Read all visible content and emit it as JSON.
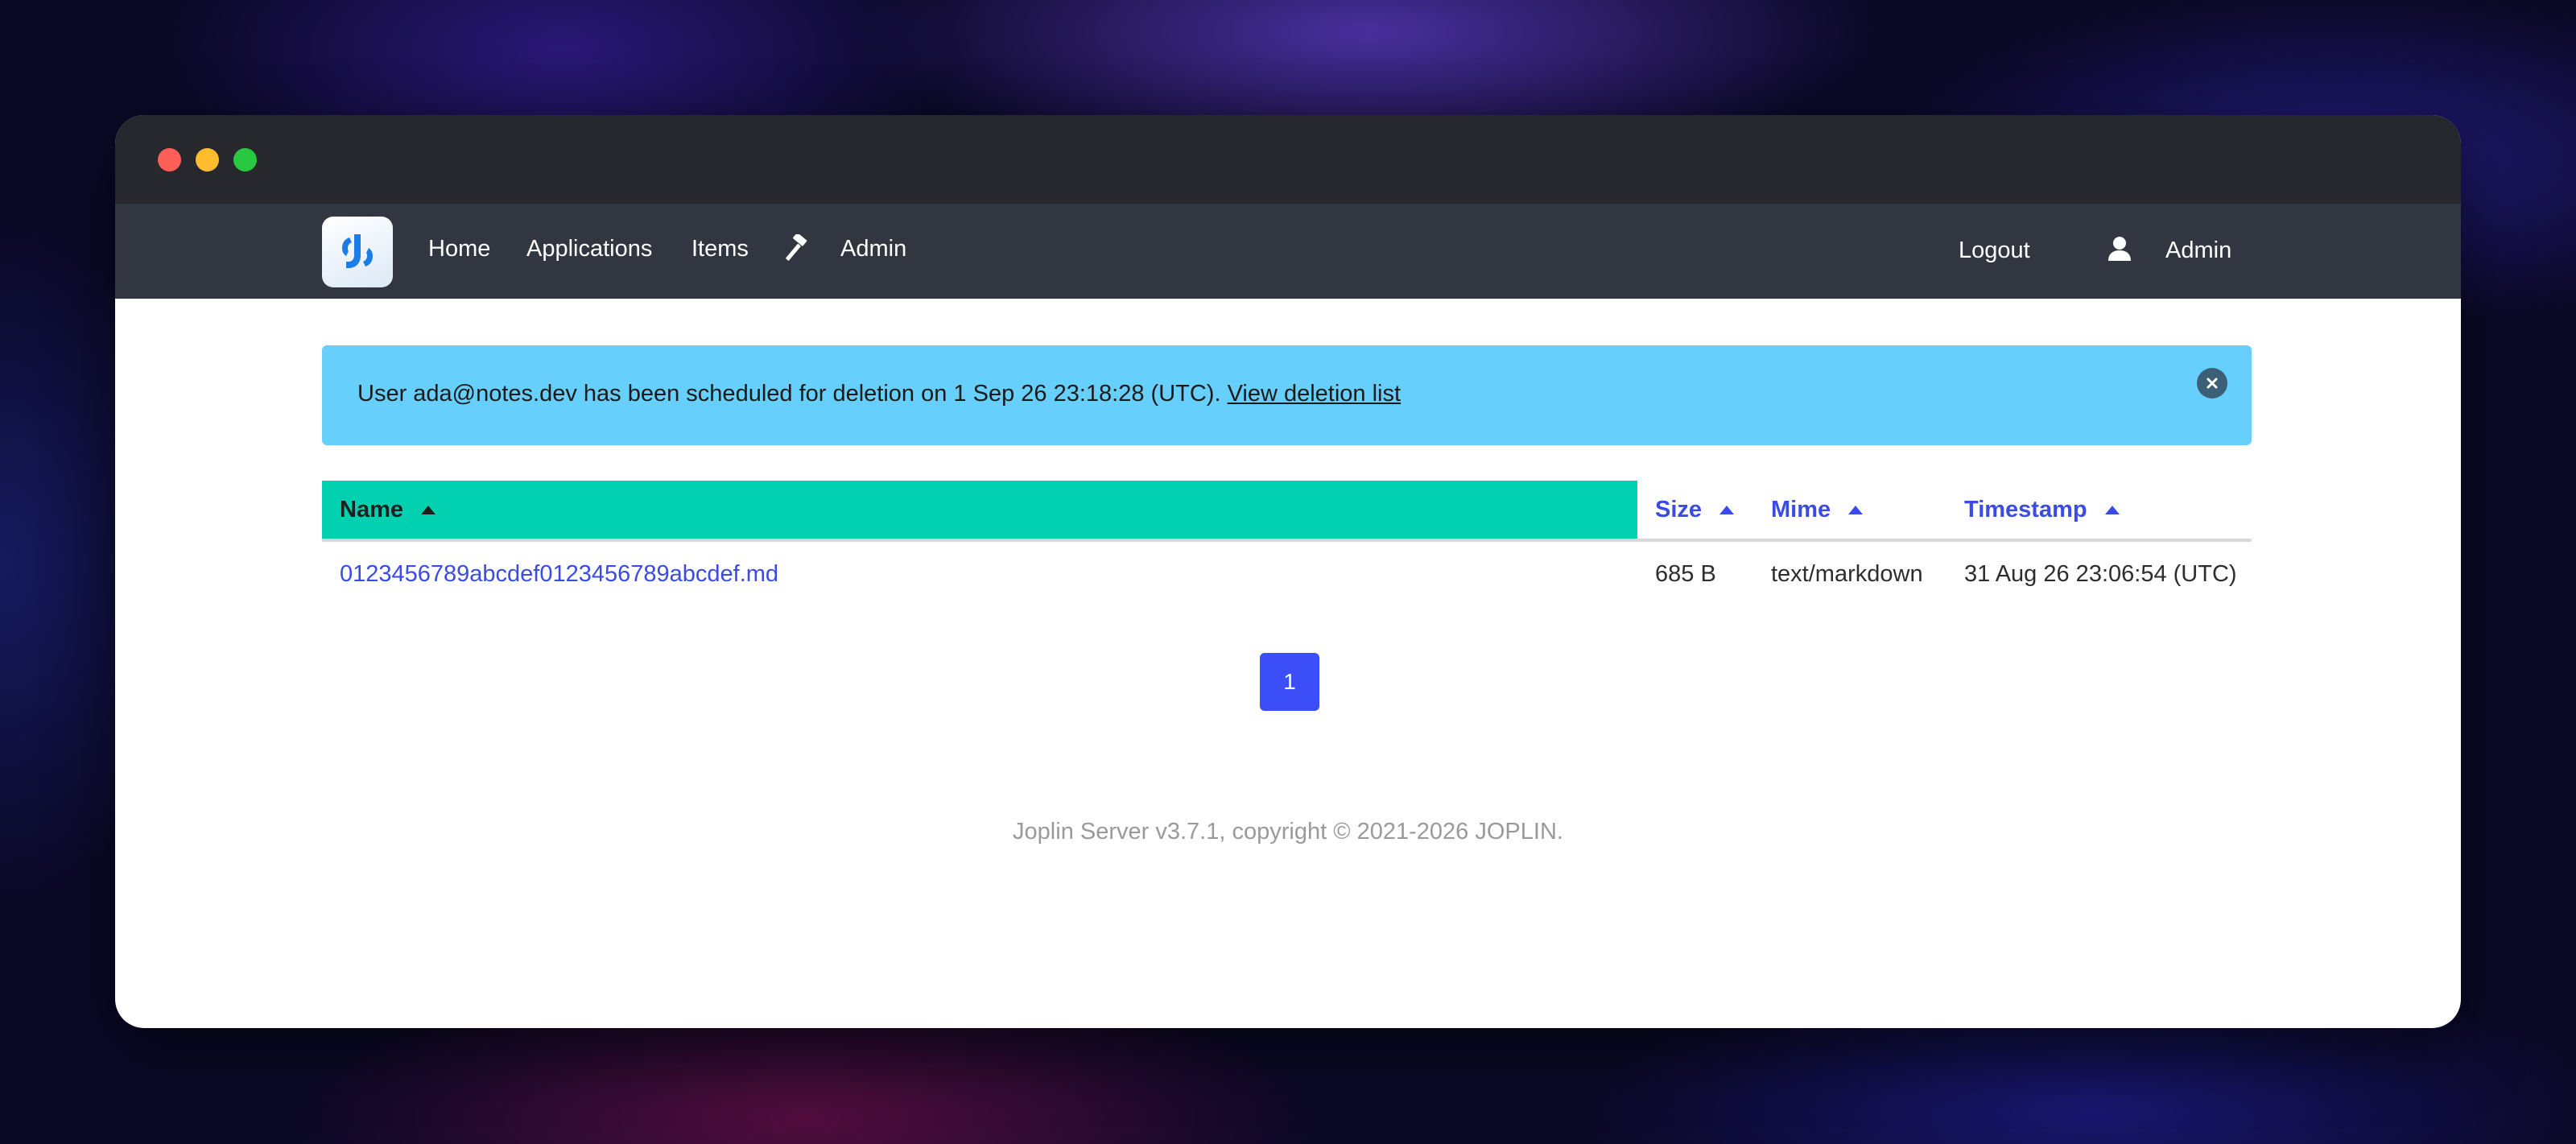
{
  "nav": {
    "home": "Home",
    "applications": "Applications",
    "items": "Items",
    "admin": "Admin",
    "logout": "Logout",
    "user": "Admin"
  },
  "alert": {
    "message": "User ada@notes.dev has been scheduled for deletion on 1 Sep 26 23:18:28 (UTC).",
    "link": "View deletion list"
  },
  "table": {
    "headers": {
      "name": "Name",
      "size": "Size",
      "mime": "Mime",
      "timestamp": "Timestamp"
    },
    "rows": [
      {
        "name": "0123456789abcdef0123456789abcdef.md",
        "size": "685 B",
        "mime": "text/markdown",
        "timestamp": "31 Aug 26 23:06:54 (UTC)"
      }
    ]
  },
  "pagination": {
    "current": "1"
  },
  "footer": "Joplin Server v3.7.1, copyright © 2021-2026 JOPLIN.",
  "colors": {
    "active_header": "#01d1b0",
    "link": "#3a4be6",
    "alert": "#67cffb",
    "navbar": "#313640",
    "pager": "#3b4ef7"
  },
  "icons": [
    "joplin-logo-icon",
    "hammer-icon",
    "user-icon",
    "close-icon",
    "sort-asc-icon"
  ]
}
